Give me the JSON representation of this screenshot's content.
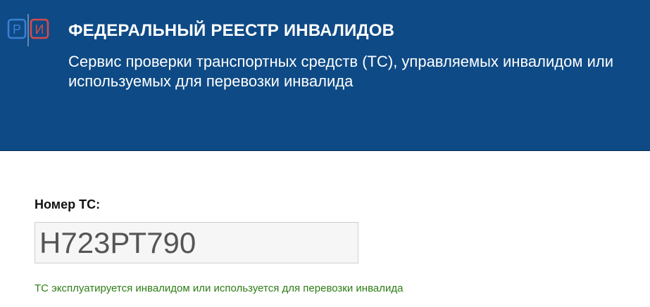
{
  "header": {
    "logo": {
      "letter_left": "Р",
      "letter_right": "И",
      "color_left": "#3a7fd5",
      "color_right": "#d84a4a"
    },
    "title": "ФЕДЕРАЛЬНЫЙ РЕЕСТР ИНВАЛИДОВ",
    "subtitle": "Сервис проверки транспортных средств (ТС), управляемых инвалидом или используемых для перевозки инвалида",
    "background_color": "#0e4a85"
  },
  "form": {
    "plate_label": "Номер ТС:",
    "plate_value": "Н723РТ790",
    "status_text": "ТС эксплуатируется инвалидом или используется для перевозки инвалида",
    "status_color": "#2e7d16"
  }
}
